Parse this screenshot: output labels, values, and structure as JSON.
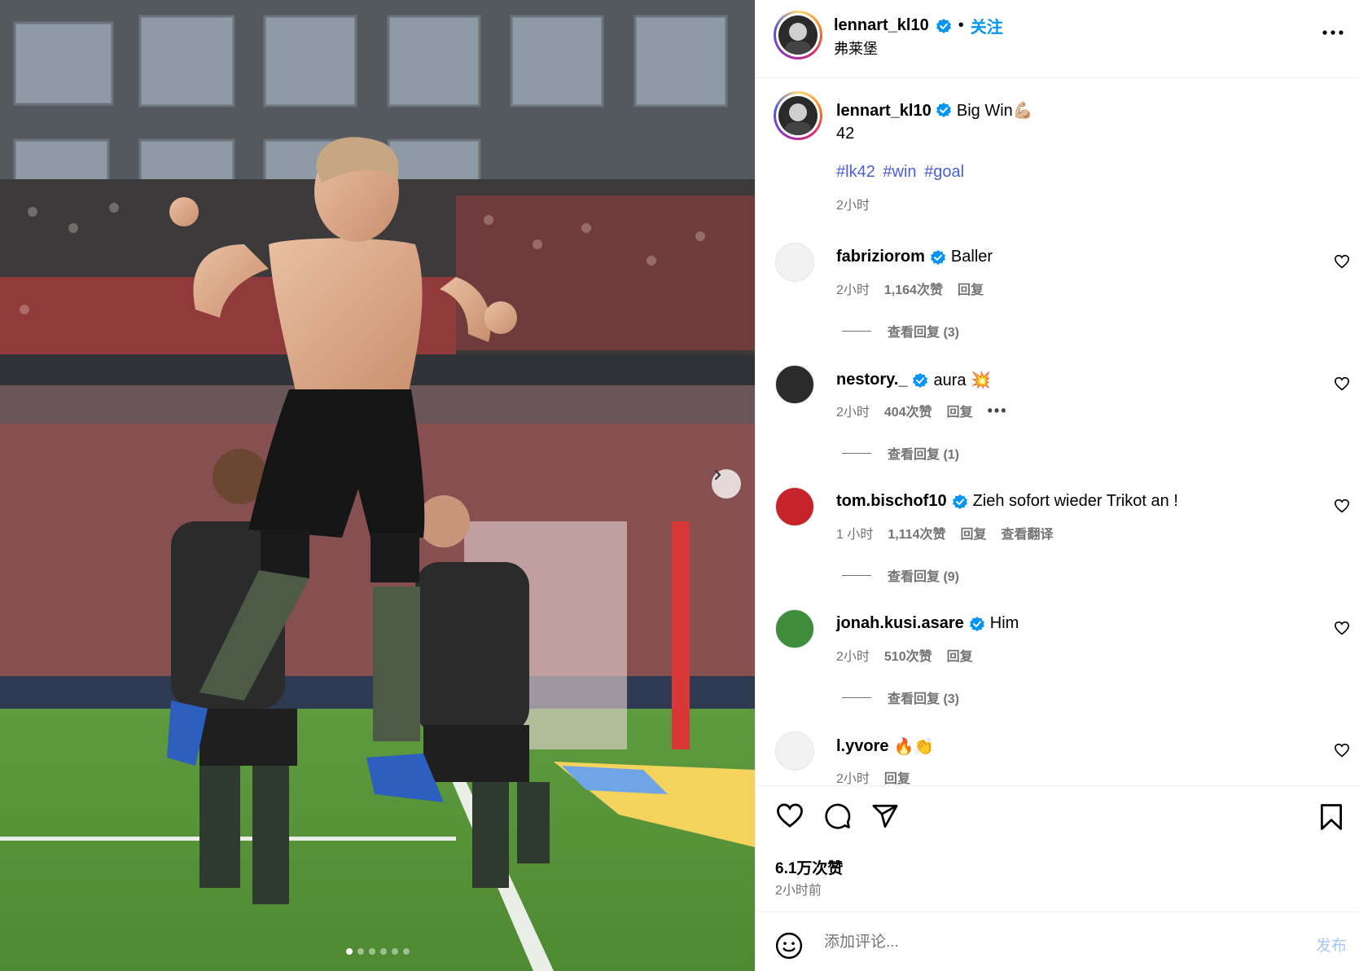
{
  "header": {
    "username": "lennart_kl10",
    "separator": "•",
    "follow_label": "关注",
    "location": "弗莱堡",
    "more_icon": "more-horizontal-icon"
  },
  "caption": {
    "username": "lennart_kl10",
    "text": "Big Win💪🏼",
    "number": "42",
    "hashtags": [
      "#lk42",
      "#win",
      "#goal"
    ],
    "time": "2小时"
  },
  "comments": [
    {
      "username": "fabriziorom",
      "text": "Baller",
      "time": "2小时",
      "likes": "1,164次赞",
      "reply": "回复",
      "view_replies": "查看回复 (3)",
      "avatar_color": "#f2f2f2"
    },
    {
      "username": "nestory._",
      "text": "aura 💥",
      "time": "2小时",
      "likes": "404次赞",
      "reply": "回复",
      "more": "•••",
      "view_replies": "查看回复 (1)",
      "avatar_color": "#2b2b2b"
    },
    {
      "username": "tom.bischof10",
      "text": "Zieh sofort wieder Trikot an !",
      "time": "1 小时",
      "likes": "1,114次赞",
      "reply": "回复",
      "translate": "查看翻译",
      "view_replies": "查看回复 (9)",
      "avatar_color": "#c6232b"
    },
    {
      "username": "jonah.kusi.asare",
      "text": "Him",
      "time": "2小时",
      "likes": "510次赞",
      "reply": "回复",
      "view_replies": "查看回复 (3)",
      "avatar_color": "#3f8c3a"
    },
    {
      "username": "l.yvore",
      "text": "🔥👏",
      "time": "2小时",
      "reply": "回复",
      "avatar_color": "#f2f2f2"
    }
  ],
  "actions": {
    "like_icon": "heart-icon",
    "comment_icon": "comment-icon",
    "share_icon": "share-icon",
    "save_icon": "bookmark-icon",
    "likes": "6.1万次赞",
    "time": "2小时前"
  },
  "add_comment": {
    "placeholder": "添加评论...",
    "publish_label": "发布",
    "emoji_icon": "emoji-icon"
  },
  "carousel": {
    "total": 6,
    "active": 0,
    "next_icon": "chevron-right-icon"
  },
  "colors": {
    "link": "#0095f6",
    "hashtag": "#4a5fd8",
    "muted": "#737373",
    "verified": "#0095f6"
  }
}
